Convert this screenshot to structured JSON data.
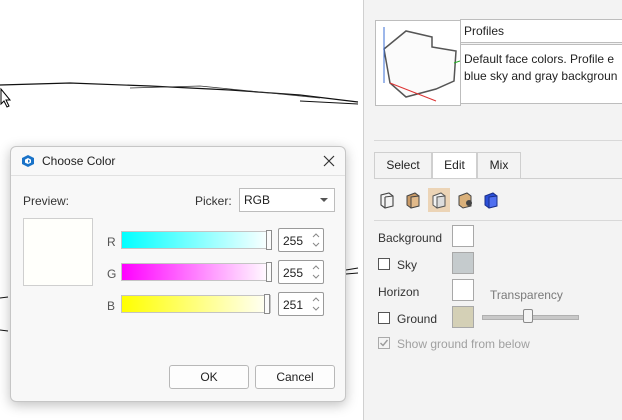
{
  "panel": {
    "style_name": "Profiles",
    "style_desc_line1": "Default face colors. Profile e",
    "style_desc_line2": "blue sky and gray backgroun",
    "tabs": [
      {
        "label": "Select"
      },
      {
        "label": "Edit"
      },
      {
        "label": "Mix"
      }
    ],
    "active_tab": "Edit",
    "icons": [
      "edge-settings-icon",
      "face-settings-icon",
      "background-settings-icon",
      "watermark-settings-icon",
      "modeling-settings-icon"
    ],
    "background": {
      "background_label": "Background",
      "background_color": "#ffffff",
      "sky_label": "Sky",
      "sky_checked": false,
      "sky_color": "#c5cbcd",
      "horizon_label": "Horizon",
      "horizon_color": "#ffffff",
      "transparency_label": "Transparency",
      "transparency_value": 0.5,
      "ground_label": "Ground",
      "ground_checked": false,
      "ground_color": "#d4d0b6",
      "show_ground_label": "Show ground from below",
      "show_ground_checked": true
    }
  },
  "dialog": {
    "title": "Choose Color",
    "preview_label": "Preview:",
    "preview_color": "#fffffb",
    "picker_label": "Picker:",
    "picker_value": "RGB",
    "channels": [
      {
        "label": "R",
        "value": "255",
        "gradient_from": "#00ffff",
        "gradient_to": "#ffffff"
      },
      {
        "label": "G",
        "value": "255",
        "gradient_from": "#ff00ff",
        "gradient_to": "#ffffff"
      },
      {
        "label": "B",
        "value": "251",
        "gradient_from": "#ffff00",
        "gradient_to": "#fffffb"
      }
    ],
    "ok_label": "OK",
    "cancel_label": "Cancel"
  },
  "colors": {
    "accent": "#1a73c8",
    "selected_icon_bg": "#ecd4b6"
  }
}
